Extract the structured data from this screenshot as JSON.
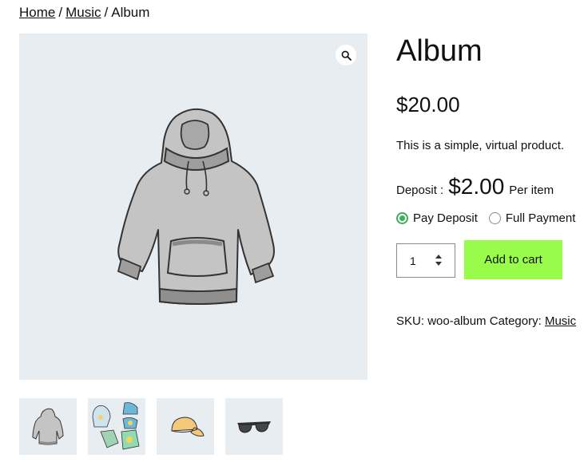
{
  "breadcrumb": {
    "home": "Home",
    "separator": "/",
    "category": "Music",
    "current": "Album"
  },
  "gallery": {
    "main_image": "hoodie-image",
    "zoom_icon": "magnifier-icon",
    "thumbnails": [
      "hoodie-thumbnail",
      "hoodie-bundle-thumbnail",
      "cap-thumbnail",
      "sunglasses-thumbnail"
    ]
  },
  "product": {
    "title": "Album",
    "price": "$20.00",
    "short_description": "This is a simple, virtual product."
  },
  "deposit": {
    "label": "Deposit :",
    "amount": "$2.00",
    "per": "Per item",
    "options": [
      {
        "label": "Pay Deposit",
        "selected": true
      },
      {
        "label": "Full Payment",
        "selected": false
      }
    ]
  },
  "cart": {
    "quantity": "1",
    "add_to_cart_label": "Add to cart"
  },
  "meta": {
    "sku_label": "SKU:",
    "sku": "woo-album",
    "category_label": "Category:",
    "category": "Music"
  },
  "colors": {
    "gallery_bg": "#e8edf2",
    "button_bg": "#9afc4a",
    "radio_accent": "#3fae5b"
  }
}
